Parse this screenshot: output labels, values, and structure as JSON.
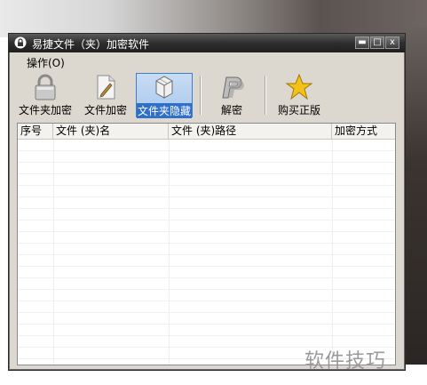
{
  "window": {
    "title": "易捷文件（夹）加密软件",
    "controls": {
      "minimize": "▬",
      "maximize": "□",
      "close": "x"
    }
  },
  "menu": {
    "operate": "操作(O)"
  },
  "toolbar": {
    "items": [
      {
        "label": "文件夹加密",
        "icon": "padlock-icon"
      },
      {
        "label": "文件加密",
        "icon": "document-pen-icon"
      },
      {
        "label": "文件夹隐藏",
        "icon": "hidden-box-icon"
      },
      {
        "label": "解密",
        "icon": "p-logo-icon"
      },
      {
        "label": "购买正版",
        "icon": "star-icon"
      }
    ]
  },
  "list": {
    "columns": [
      "序号",
      "文件 (夹)名",
      "文件 (夹)路径",
      "加密方式"
    ]
  },
  "watermark": "软件技巧",
  "colors": {
    "titlebar": "#2e2e2e",
    "active_tool": "#a8c8ee",
    "window_bg": "#dcd8cf"
  }
}
